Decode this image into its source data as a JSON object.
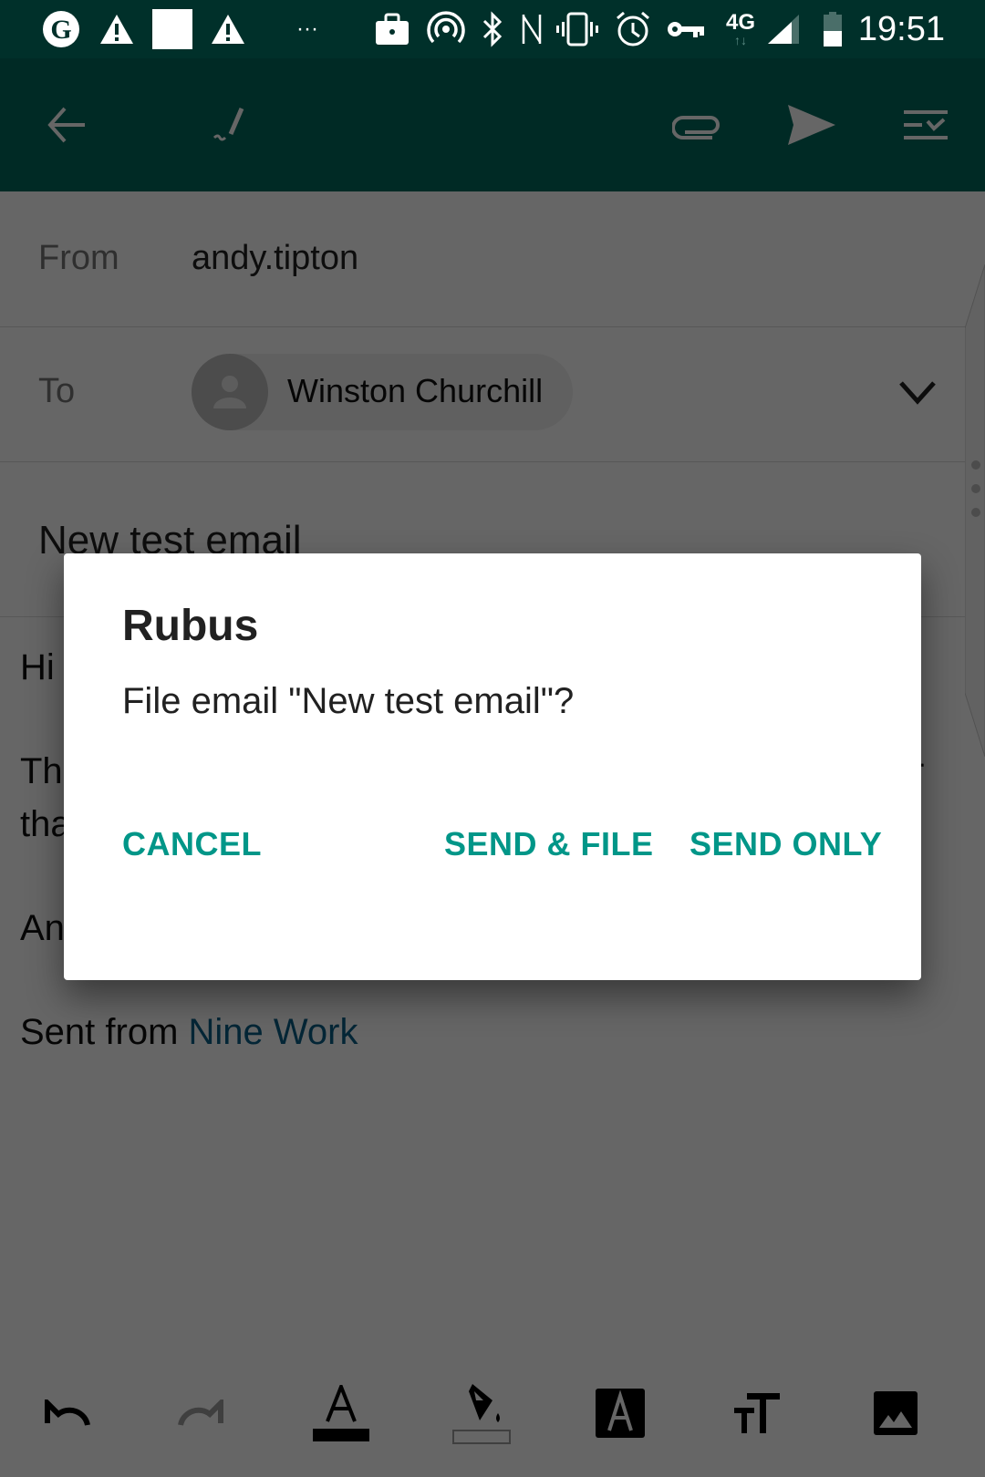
{
  "status_bar": {
    "time": "19:51",
    "network": "4G",
    "icons": [
      "guardian-g-icon",
      "warning-icon",
      "blank-square-icon",
      "warning-icon",
      "more-dots-icon",
      "briefcase-icon",
      "hotspot-icon",
      "bluetooth-icon",
      "nfc-icon",
      "vibrate-icon",
      "alarm-icon",
      "vpn-key-icon",
      "4g-data-icon",
      "signal-icon",
      "battery-icon"
    ],
    "more_dots": "···"
  },
  "toolbar": {
    "icons": [
      "back-arrow-icon",
      "signature-pen-icon",
      "attach-icon",
      "send-icon",
      "checklist-menu-icon"
    ]
  },
  "compose": {
    "from_label": "From",
    "from_value": "andy.tipton",
    "to_label": "To",
    "to_recipient": "Winston Churchill",
    "subject": "New test email",
    "body_lines": [
      "Hi",
      "Th",
      "tha",
      "An"
    ],
    "body_right_fragment": "r",
    "signature_prefix": "Sent from ",
    "signature_link": "Nine Work"
  },
  "format_bar": {
    "tools": [
      "undo-icon",
      "redo-icon",
      "text-color-icon",
      "highlight-fill-icon",
      "text-style-icon",
      "text-size-icon",
      "insert-image-icon"
    ],
    "text_color_swatch": "#000000"
  },
  "dialog": {
    "title": "Rubus",
    "message": "File email \"New test email\"?",
    "cancel_label": "CANCEL",
    "send_file_label": "SEND & FILE",
    "send_only_label": "SEND ONLY",
    "accent_color": "#009688"
  }
}
